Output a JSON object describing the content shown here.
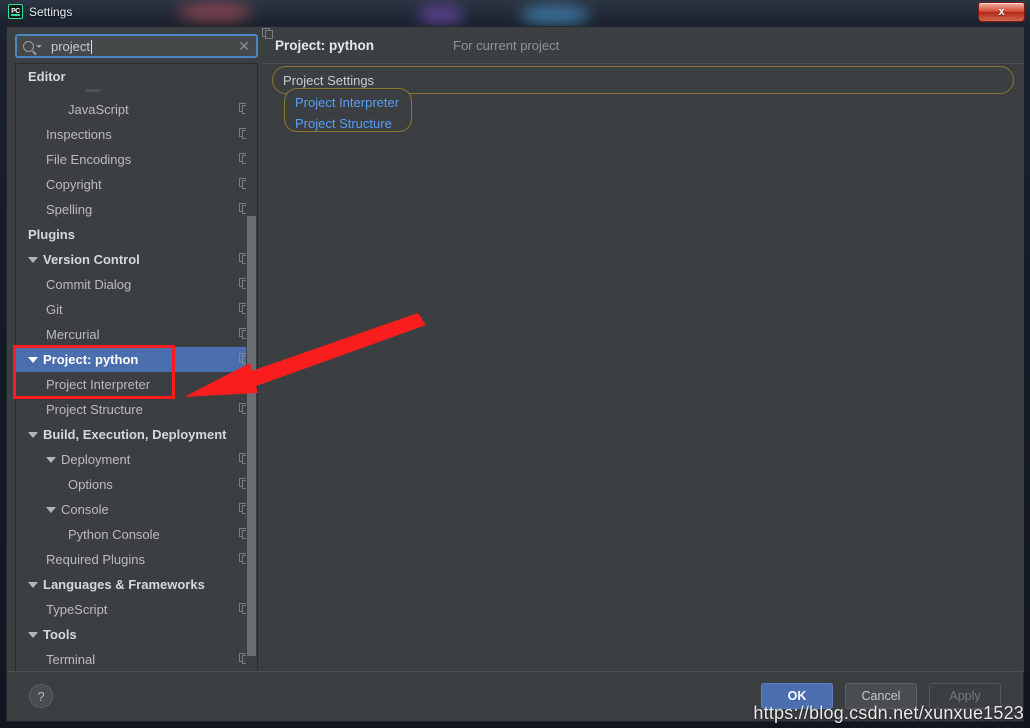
{
  "window": {
    "title": "Settings",
    "app_icon": "pycharm-icon",
    "close_label": "x"
  },
  "search": {
    "value": "project",
    "placeholder": "",
    "icon": "search-icon",
    "dropdown_icon": "chevron-down-icon",
    "clear_icon": "close-icon",
    "clear_label": "✕"
  },
  "tree": {
    "scope_icon": "copy-icon",
    "items": [
      {
        "label": "Editor",
        "level": 0,
        "group": true,
        "arrow": false,
        "scope_icon": false,
        "selected": false
      },
      {
        "label": "JavaScript",
        "level": 2,
        "group": false,
        "arrow": false,
        "scope_icon": true,
        "selected": false
      },
      {
        "label": "Inspections",
        "level": 1,
        "group": false,
        "arrow": false,
        "scope_icon": true,
        "selected": false
      },
      {
        "label": "File Encodings",
        "level": 1,
        "group": false,
        "arrow": false,
        "scope_icon": true,
        "selected": false
      },
      {
        "label": "Copyright",
        "level": 1,
        "group": false,
        "arrow": false,
        "scope_icon": true,
        "selected": false
      },
      {
        "label": "Spelling",
        "level": 1,
        "group": false,
        "arrow": false,
        "scope_icon": true,
        "selected": false
      },
      {
        "label": "Plugins",
        "level": 0,
        "group": true,
        "arrow": false,
        "scope_icon": false,
        "selected": false
      },
      {
        "label": "Version Control",
        "level": 0,
        "group": true,
        "arrow": true,
        "scope_icon": true,
        "selected": false
      },
      {
        "label": "Commit Dialog",
        "level": 1,
        "group": false,
        "arrow": false,
        "scope_icon": true,
        "selected": false
      },
      {
        "label": "Git",
        "level": 1,
        "group": false,
        "arrow": false,
        "scope_icon": true,
        "selected": false
      },
      {
        "label": "Mercurial",
        "level": 1,
        "group": false,
        "arrow": false,
        "scope_icon": true,
        "selected": false
      },
      {
        "label": "Project: python",
        "level": 0,
        "group": true,
        "arrow": true,
        "scope_icon": true,
        "selected": true
      },
      {
        "label": "Project Interpreter",
        "level": 1,
        "group": false,
        "arrow": false,
        "scope_icon": true,
        "selected": false
      },
      {
        "label": "Project Structure",
        "level": 1,
        "group": false,
        "arrow": false,
        "scope_icon": true,
        "selected": false
      },
      {
        "label": "Build, Execution, Deployment",
        "level": 0,
        "group": true,
        "arrow": true,
        "scope_icon": false,
        "selected": false
      },
      {
        "label": "Deployment",
        "level": 1,
        "group": false,
        "arrow": true,
        "scope_icon": true,
        "selected": false
      },
      {
        "label": "Options",
        "level": 2,
        "group": false,
        "arrow": false,
        "scope_icon": true,
        "selected": false
      },
      {
        "label": "Console",
        "level": 1,
        "group": false,
        "arrow": true,
        "scope_icon": true,
        "selected": false
      },
      {
        "label": "Python Console",
        "level": 2,
        "group": false,
        "arrow": false,
        "scope_icon": true,
        "selected": false
      },
      {
        "label": "Required Plugins",
        "level": 1,
        "group": false,
        "arrow": false,
        "scope_icon": true,
        "selected": false
      },
      {
        "label": "Languages & Frameworks",
        "level": 0,
        "group": true,
        "arrow": true,
        "scope_icon": false,
        "selected": false
      },
      {
        "label": "TypeScript",
        "level": 1,
        "group": false,
        "arrow": false,
        "scope_icon": true,
        "selected": false
      },
      {
        "label": "Tools",
        "level": 0,
        "group": true,
        "arrow": true,
        "scope_icon": false,
        "selected": false
      },
      {
        "label": "Terminal",
        "level": 1,
        "group": false,
        "arrow": false,
        "scope_icon": true,
        "selected": false
      }
    ]
  },
  "detail": {
    "title": "Project: python",
    "scope_note": "For current project",
    "scope_note_icon": "copy-icon",
    "group_title": "Project Settings",
    "links": [
      {
        "label": "Project Interpreter"
      },
      {
        "label": "Project Structure"
      }
    ]
  },
  "buttons": {
    "help_label": "?",
    "ok_label": "OK",
    "cancel_label": "Cancel",
    "apply_label": "Apply"
  },
  "annotations": {
    "watermark": "https://blog.csdn.net/xunxue1523",
    "highlight_box": "red-highlight-box",
    "arrow": "red-arrow"
  },
  "colors": {
    "accent_selection": "#4b6eaf",
    "link": "#589df6",
    "search_match_outline": "#8d7531",
    "annotation_red": "#f91d1d",
    "panel_bg": "#3c3f41"
  }
}
